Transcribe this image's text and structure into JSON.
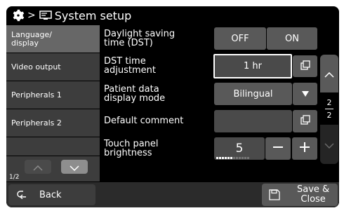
{
  "header": {
    "separator": ">",
    "title": "System setup",
    "gear_icon": "gear-icon",
    "system_icon": "system-setup-icon"
  },
  "sidebar": {
    "items": [
      {
        "label_line1": "Language/",
        "label_line2": "display",
        "active": true
      },
      {
        "label_line1": "Video output",
        "label_line2": ""
      },
      {
        "label_line1": "Peripherals 1",
        "label_line2": ""
      },
      {
        "label_line1": "Peripherals 2",
        "label_line2": ""
      }
    ],
    "page_indicator": "1/2"
  },
  "settings": {
    "dst": {
      "label_line1": "Daylight saving",
      "label_line2": "time (DST)",
      "off_label": "OFF",
      "on_label": "ON"
    },
    "dst_adjust": {
      "label_line1": "DST time",
      "label_line2": "adjustment",
      "value": "1 hr"
    },
    "patient_mode": {
      "label_line1": "Patient data",
      "label_line2": "display mode",
      "value": "Bilingual"
    },
    "default_comment": {
      "label_line1": "Default comment",
      "label_line2": "",
      "value": ""
    },
    "brightness": {
      "label_line1": "Touch panel",
      "label_line2": "brightness",
      "value": "5",
      "level_fraction": 0.5
    }
  },
  "scrollbar": {
    "current_page": "2",
    "total_pages": "2"
  },
  "footer": {
    "back_label": "Back",
    "save_label_line1": "Save &",
    "save_label_line2": "Close"
  },
  "colors": {
    "selected_border": "#ffffff",
    "active_sidebar": "#676767",
    "button": "#595959"
  }
}
